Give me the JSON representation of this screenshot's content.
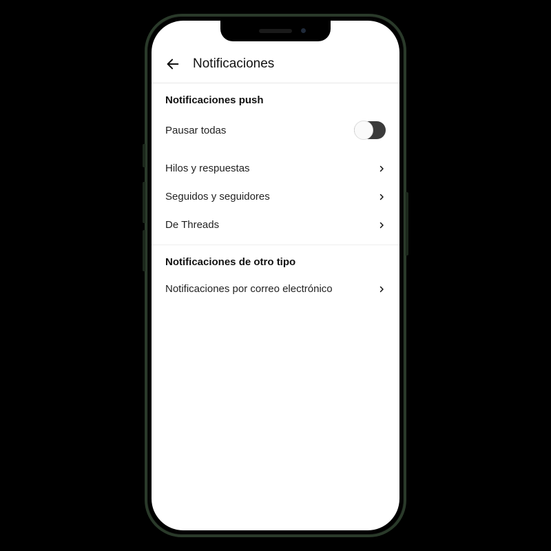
{
  "header": {
    "title": "Notificaciones"
  },
  "push_section": {
    "heading": "Notificaciones push",
    "pause_all_label": "Pausar todas",
    "pause_all_on": false,
    "items": [
      {
        "label": "Hilos y respuestas"
      },
      {
        "label": "Seguidos y seguidores"
      },
      {
        "label": "De Threads"
      }
    ]
  },
  "other_section": {
    "heading": "Notificaciones de otro tipo",
    "items": [
      {
        "label": "Notificaciones por correo electrónico"
      }
    ]
  }
}
